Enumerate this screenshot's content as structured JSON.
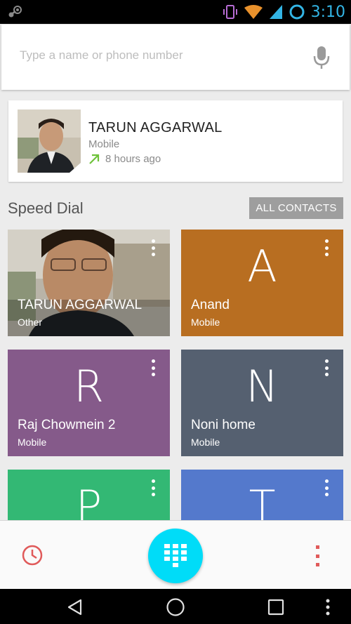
{
  "status_bar": {
    "time": "3:10"
  },
  "search": {
    "placeholder": "Type a name or phone number"
  },
  "recent_call": {
    "name": "TARUN AGGARWAL",
    "type": "Mobile",
    "time": "8 hours ago"
  },
  "speed_dial": {
    "title": "Speed Dial",
    "all_contacts_label": "ALL CONTACTS",
    "tiles": [
      {
        "name": "TARUN AGGARWAL",
        "type": "Other",
        "letter": "",
        "color": "#6b6b6b"
      },
      {
        "name": "Anand",
        "type": "Mobile",
        "letter": "A",
        "color": "#b86e21"
      },
      {
        "name": "Raj Chowmein 2",
        "type": "Mobile",
        "letter": "R",
        "color": "#855a8a"
      },
      {
        "name": "Noni home",
        "type": "Mobile",
        "letter": "N",
        "color": "#556070"
      },
      {
        "name": "",
        "type": "",
        "letter": "P",
        "color": "#33b874"
      },
      {
        "name": "",
        "type": "",
        "letter": "T",
        "color": "#5479cc"
      }
    ]
  },
  "icons": {
    "status": [
      "steam-icon",
      "vibrate-icon",
      "wifi-icon",
      "cell-signal-icon",
      "battery-icon"
    ],
    "bottom": [
      "history-icon",
      "dialpad-icon",
      "overflow-menu-icon"
    ],
    "nav": [
      "back-icon",
      "home-icon",
      "recents-icon",
      "nav-overflow-icon"
    ]
  },
  "colors": {
    "accent": "#00dcf8",
    "status_accent": "#33b5e5",
    "call_arrow": "#6ec23a",
    "history": "#e05a5a"
  }
}
